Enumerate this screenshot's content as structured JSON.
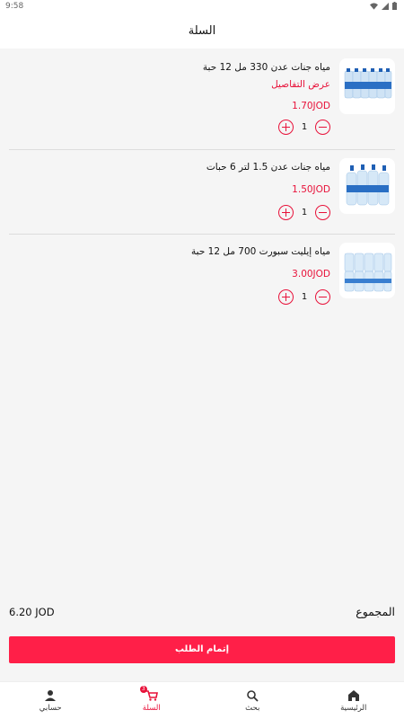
{
  "status_bar": {
    "time": "9:58"
  },
  "header": {
    "title": "السلة"
  },
  "cart": {
    "items": [
      {
        "name": "مياه جنات عدن 330 مل 12 حبة",
        "details_link": "عرض التفاصيل",
        "price": "1.70JOD",
        "quantity": "1"
      },
      {
        "name": "مياه جنات عدن 1.5 لتر 6 حبات",
        "price": "1.50JOD",
        "quantity": "1"
      },
      {
        "name": "مياه إيليت سبورت 700 مل 12 حبة",
        "price": "3.00JOD",
        "quantity": "1"
      }
    ]
  },
  "summary": {
    "total_label": "المجموع",
    "total_value": "6.20 JOD"
  },
  "checkout": {
    "label": "إتمام الطلب"
  },
  "bottom_nav": {
    "items": [
      {
        "label": "حسابي",
        "icon": "person-icon"
      },
      {
        "label": "السلة",
        "icon": "cart-icon",
        "badge": "3"
      },
      {
        "label": "بحث",
        "icon": "search-icon"
      },
      {
        "label": "الرئيسية",
        "icon": "home-icon"
      }
    ]
  },
  "colors": {
    "accent": "#e8123a",
    "checkout_bg": "#ff1f48",
    "background": "#f5f5f5"
  }
}
